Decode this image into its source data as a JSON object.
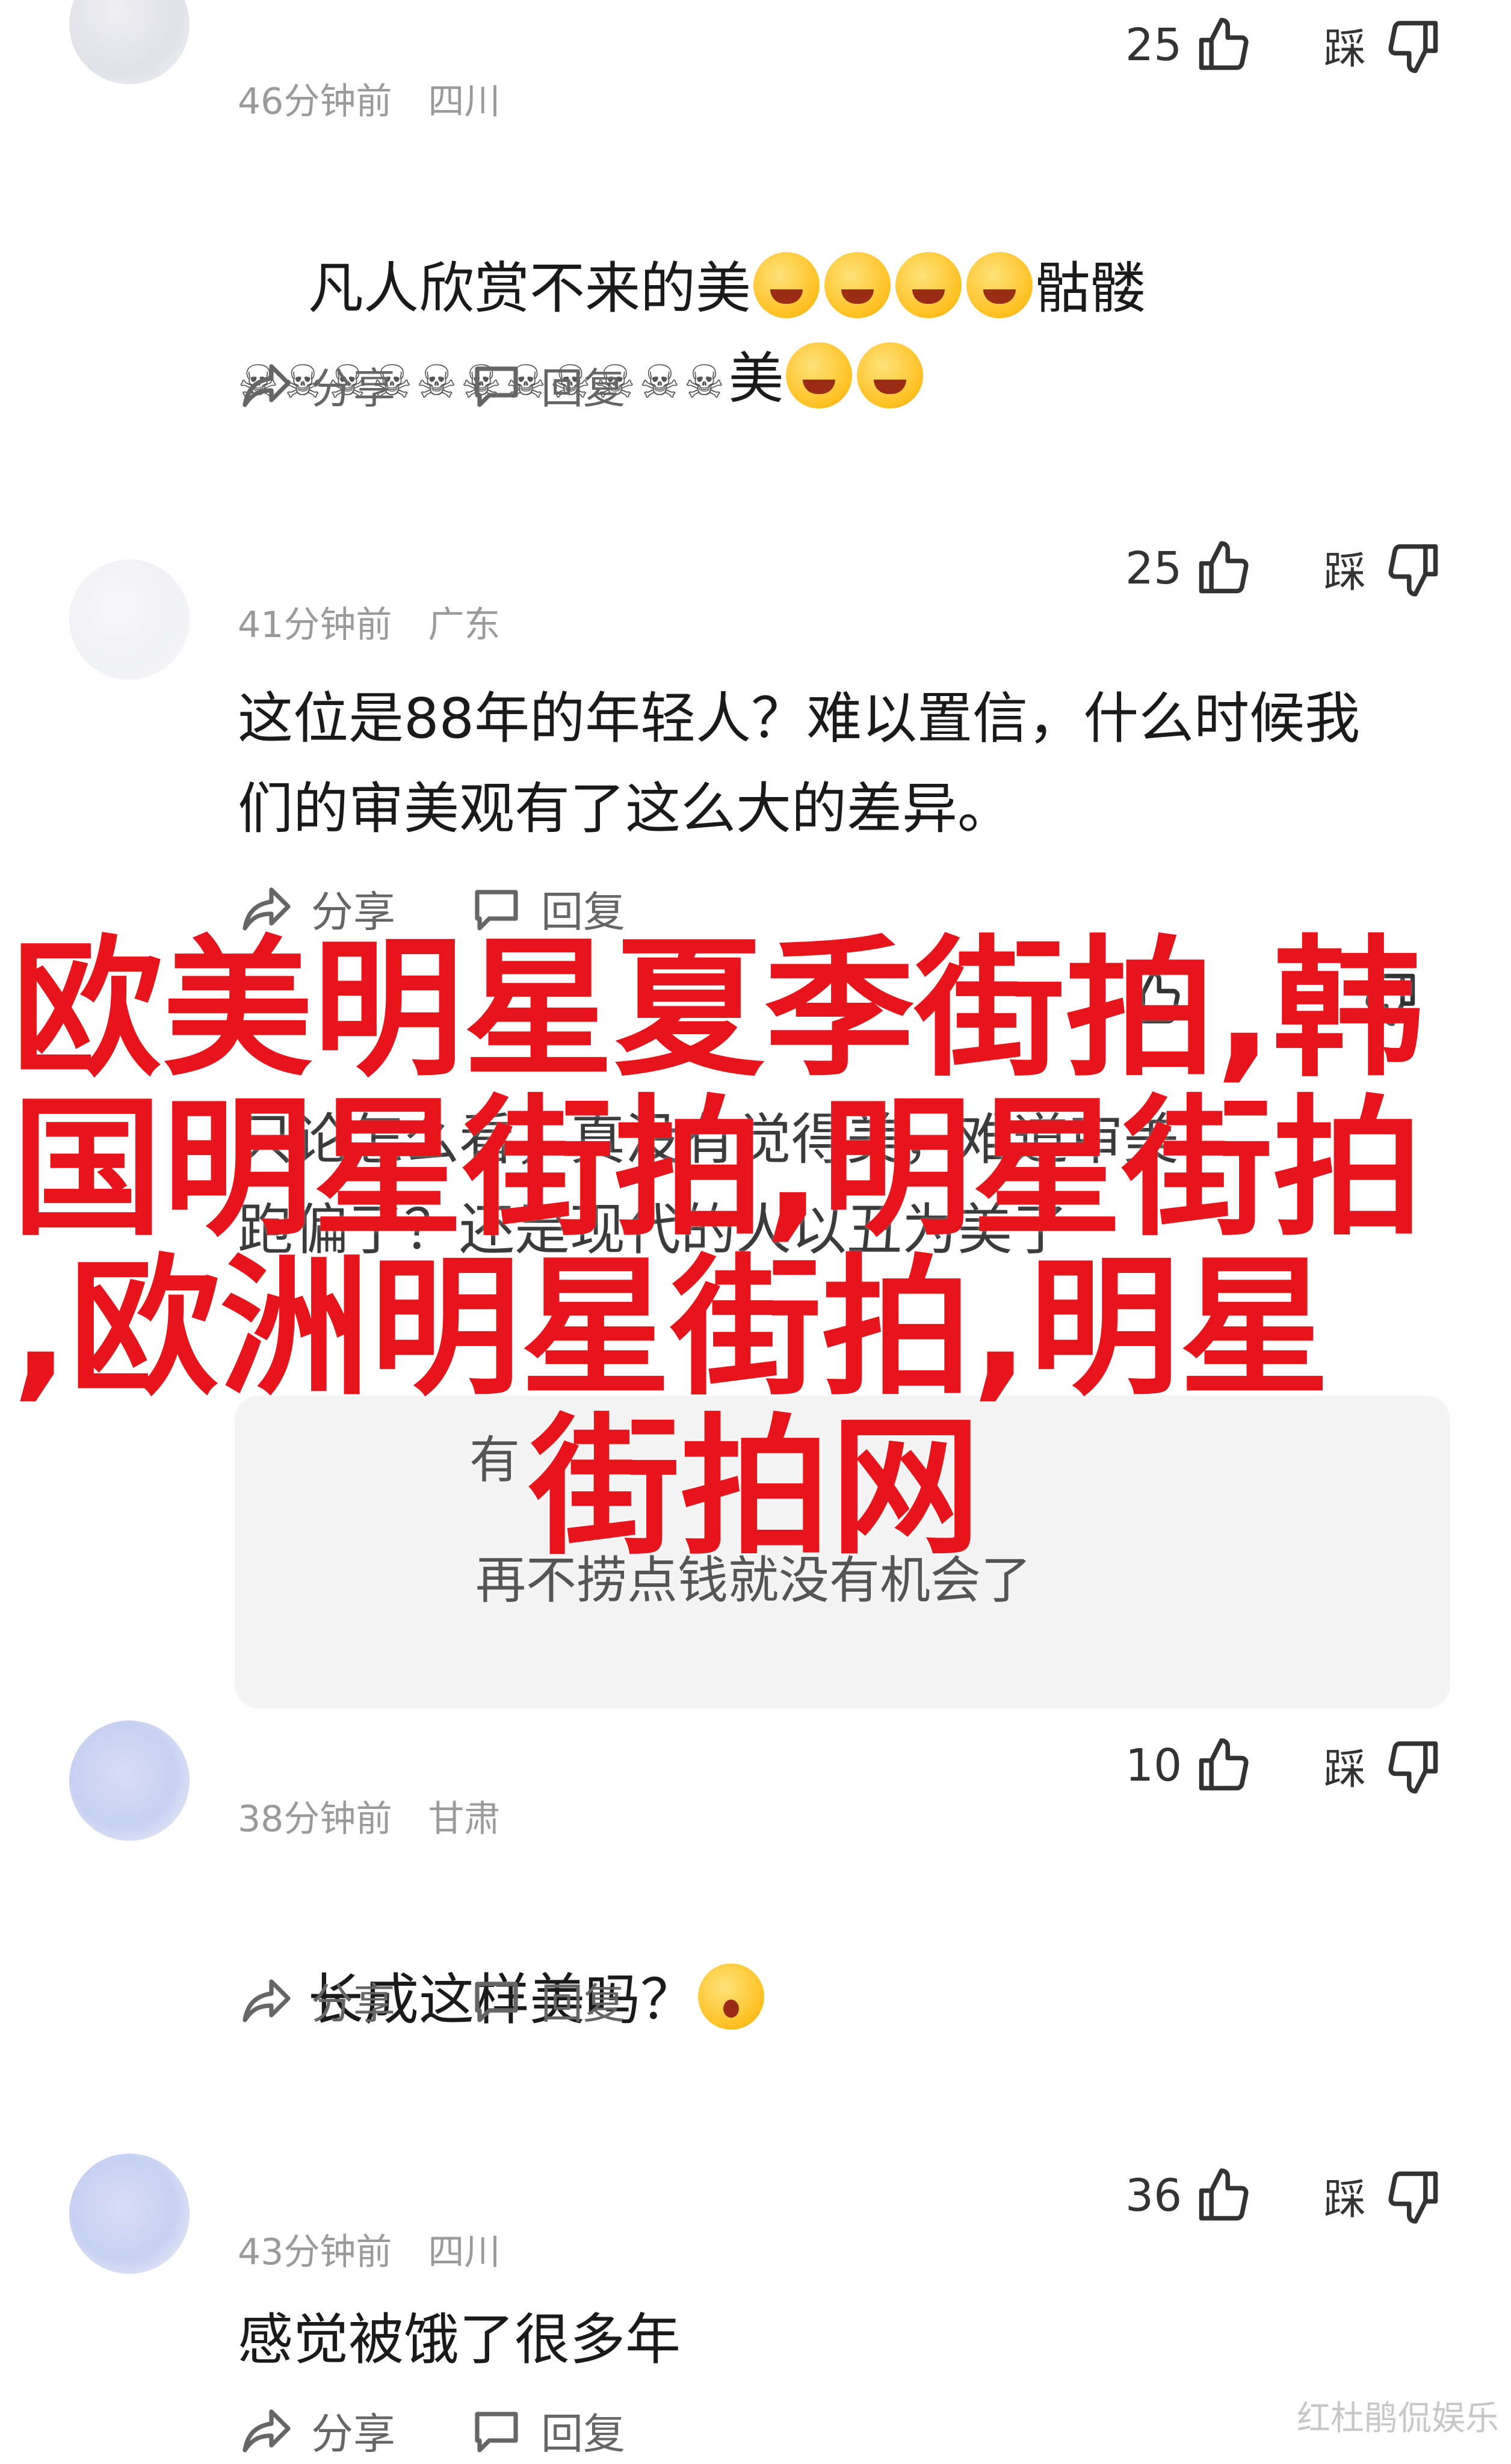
{
  "comments": [
    {
      "time": "46分钟前",
      "location": "四川",
      "likes": "25",
      "dislike_label": "踩",
      "text_line1": "凡人欣赏不来的美",
      "text_line1_tail": "骷髅",
      "text_line2_skulls": "☠☠☠☠☠☠☠☠☠☠☠",
      "text_line2_tail": "美",
      "share_label": "分享",
      "reply_label": "回复"
    },
    {
      "time": "41分钟前",
      "location": "广东",
      "likes": "25",
      "dislike_label": "踩",
      "text": "这位是88年的年轻人？难以置信，什么时候我\n们的审美观有了这么大的差异。",
      "share_label": "分享",
      "reply_label": "回复"
    },
    {
      "partial_text": "只论怎么看，真没有觉得美，难道审美\n跑偏了？还是现代的人以丑为美了",
      "reply_line1": "有",
      "reply_line2": "再不捞点钱就没有机会了"
    },
    {
      "time": "38分钟前",
      "location": "甘肃",
      "likes": "10",
      "dislike_label": "踩",
      "text": "长成这样美吗？",
      "share_label": "分享",
      "reply_label": "回复"
    },
    {
      "time": "43分钟前",
      "location": "四川",
      "likes": "36",
      "dislike_label": "踩",
      "text": "感觉被饿了很多年",
      "share_label": "分享",
      "reply_label": "回复"
    }
  ],
  "overlay_title": {
    "line1": "欧美明星夏季街拍,韩",
    "line2": "国明星街拍,明星街拍",
    "line3": ",欧洲明星街拍,明星",
    "line4": "街拍网"
  },
  "watermark": "红杜鹃侃娱乐",
  "colors": {
    "overlay_red": "#e8141b",
    "muted_text": "#9a9a9a"
  }
}
